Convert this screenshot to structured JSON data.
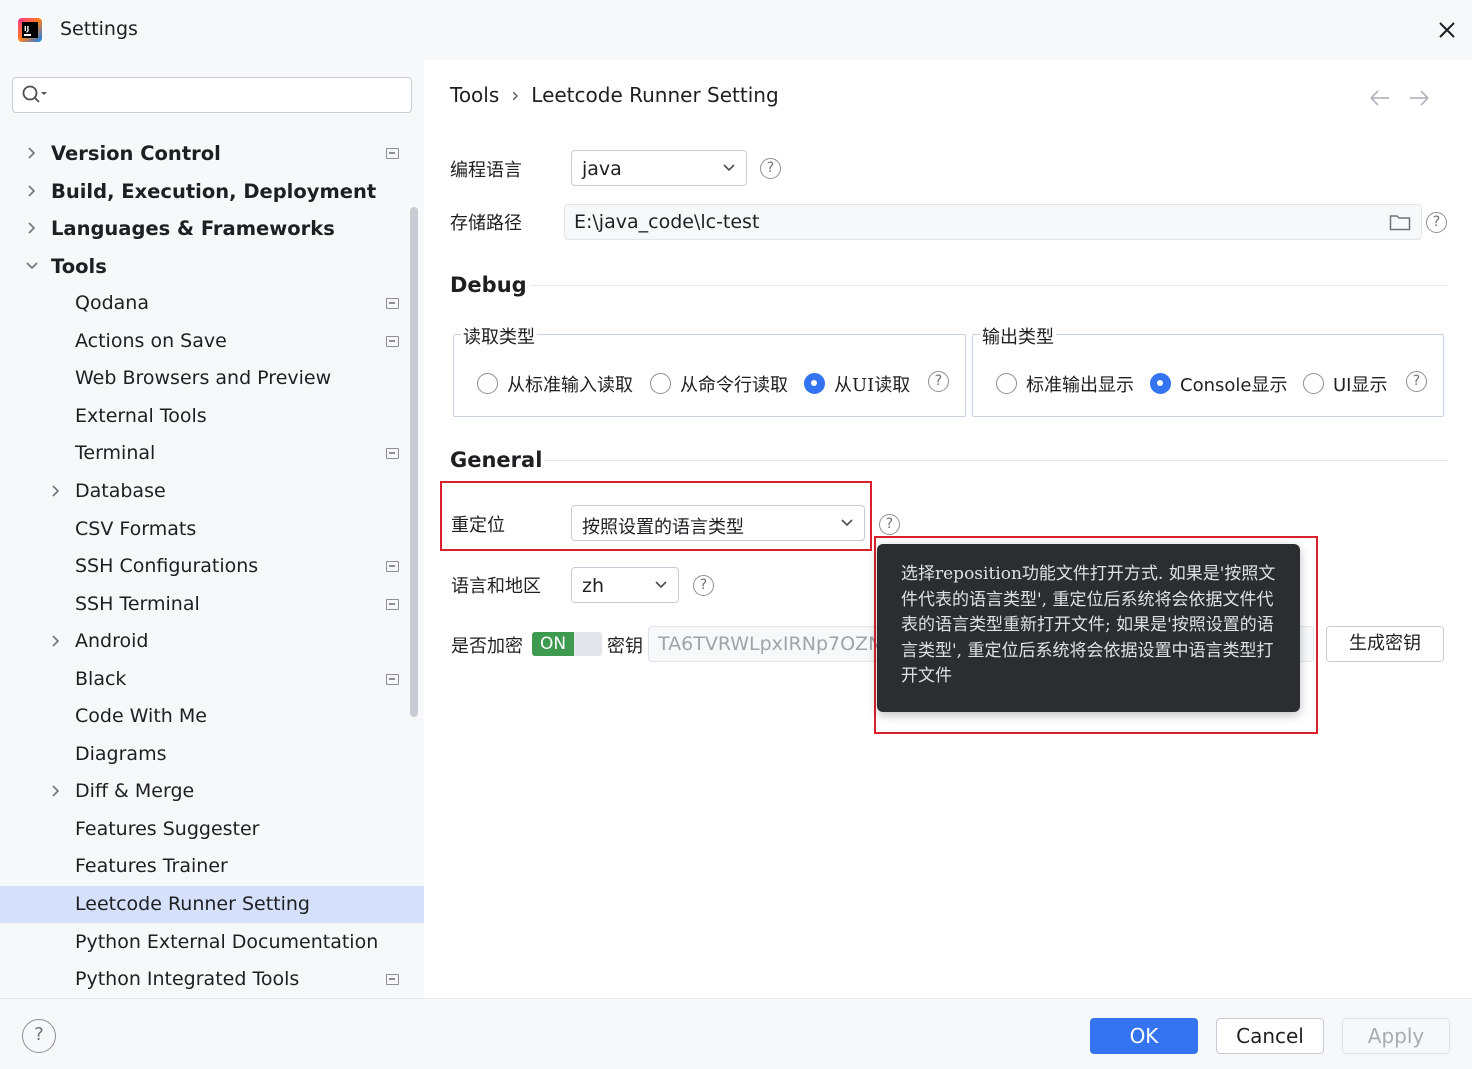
{
  "window": {
    "title": "Settings"
  },
  "search": {
    "placeholder": ""
  },
  "tree": [
    {
      "label": "Version Control",
      "level": 0,
      "arrow": "collapsed",
      "project_icon": true
    },
    {
      "label": "Build, Execution, Deployment",
      "level": 0,
      "arrow": "collapsed",
      "project_icon": false
    },
    {
      "label": "Languages & Frameworks",
      "level": 0,
      "arrow": "collapsed",
      "project_icon": false
    },
    {
      "label": "Tools",
      "level": 0,
      "arrow": "expanded",
      "project_icon": false
    },
    {
      "label": "Qodana",
      "level": 1,
      "arrow": "none",
      "project_icon": true
    },
    {
      "label": "Actions on Save",
      "level": 1,
      "arrow": "none",
      "project_icon": true
    },
    {
      "label": "Web Browsers and Preview",
      "level": 1,
      "arrow": "none",
      "project_icon": false
    },
    {
      "label": "External Tools",
      "level": 1,
      "arrow": "none",
      "project_icon": false
    },
    {
      "label": "Terminal",
      "level": 1,
      "arrow": "none",
      "project_icon": true
    },
    {
      "label": "Database",
      "level": 1,
      "arrow": "collapsed",
      "project_icon": false
    },
    {
      "label": "CSV Formats",
      "level": 1,
      "arrow": "none",
      "project_icon": false
    },
    {
      "label": "SSH Configurations",
      "level": 1,
      "arrow": "none",
      "project_icon": true
    },
    {
      "label": "SSH Terminal",
      "level": 1,
      "arrow": "none",
      "project_icon": true
    },
    {
      "label": "Android",
      "level": 1,
      "arrow": "collapsed",
      "project_icon": false
    },
    {
      "label": "Black",
      "level": 1,
      "arrow": "none",
      "project_icon": true
    },
    {
      "label": "Code With Me",
      "level": 1,
      "arrow": "none",
      "project_icon": false
    },
    {
      "label": "Diagrams",
      "level": 1,
      "arrow": "none",
      "project_icon": false
    },
    {
      "label": "Diff & Merge",
      "level": 1,
      "arrow": "collapsed",
      "project_icon": false
    },
    {
      "label": "Features Suggester",
      "level": 1,
      "arrow": "none",
      "project_icon": false
    },
    {
      "label": "Features Trainer",
      "level": 1,
      "arrow": "none",
      "project_icon": false
    },
    {
      "label": "Leetcode Runner Setting",
      "level": 1,
      "arrow": "none",
      "project_icon": false,
      "selected": true
    },
    {
      "label": "Python External Documentation",
      "level": 1,
      "arrow": "none",
      "project_icon": false
    },
    {
      "label": "Python Integrated Tools",
      "level": 1,
      "arrow": "none",
      "project_icon": true
    }
  ],
  "breadcrumb": {
    "parent": "Tools",
    "sep": "›",
    "current": "Leetcode Runner Setting"
  },
  "fields": {
    "lang_label": "编程语言",
    "lang_value": "java",
    "path_label": "存储路径",
    "path_value": "E:\\java_code\\lc-test"
  },
  "debug": {
    "title": "Debug",
    "read_group": {
      "title": "读取类型",
      "options": [
        {
          "label": "从标准输入读取",
          "checked": false
        },
        {
          "label": "从命令行读取",
          "checked": false
        },
        {
          "label": "从UI读取",
          "checked": true
        }
      ]
    },
    "output_group": {
      "title": "输出类型",
      "options": [
        {
          "label": "标准输出显示",
          "checked": false
        },
        {
          "label": "Console显示",
          "checked": true
        },
        {
          "label": "UI显示",
          "checked": false
        }
      ]
    }
  },
  "general": {
    "title": "General",
    "reposition_label": "重定位",
    "reposition_value": "按照设置的语言类型",
    "locale_label": "语言和地区",
    "locale_value": "zh",
    "encrypt_label": "是否加密",
    "toggle_text": "ON",
    "toggle_on": true,
    "key_label": "密钥",
    "key_value": "TA6TVRWLpxIRNp7OZN",
    "gen_key_button": "生成密钥"
  },
  "tooltip": {
    "text": "选择reposition功能文件打开方式. 如果是'按照文件代表的语言类型', 重定位后系统将会依据文件代表的语言类型重新打开文件; 如果是'按照设置的语言类型', 重定位后系统将会依据设置中语言类型打开文件"
  },
  "footer": {
    "help": "?",
    "ok": "OK",
    "cancel": "Cancel",
    "apply": "Apply"
  },
  "colors": {
    "accent": "#3574f0",
    "highlight": "#d9212c",
    "toggle": "#3d9a4e",
    "selection": "#d5e1fb"
  },
  "icons": {
    "help": "?"
  }
}
